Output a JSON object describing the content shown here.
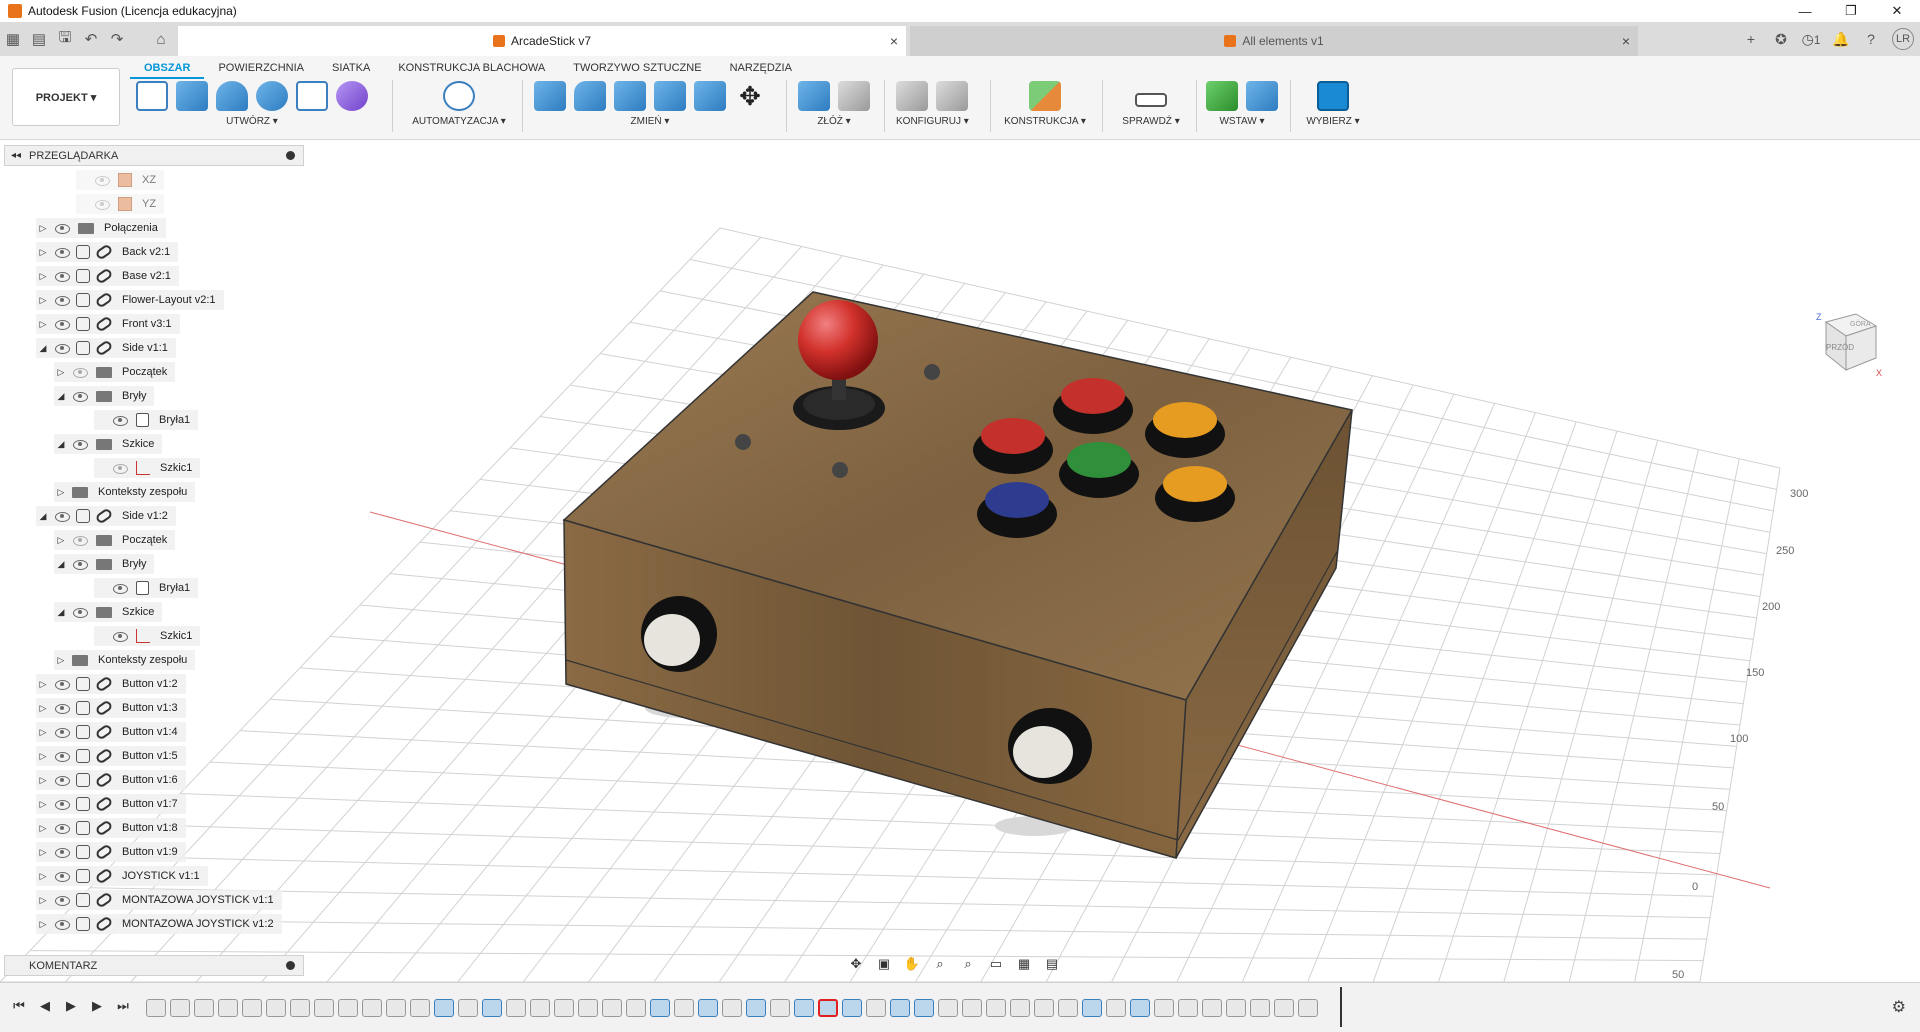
{
  "window": {
    "title": "Autodesk Fusion (Licencja edukacyjna)"
  },
  "tabs": [
    {
      "label": "ArcadeStick v7",
      "active": true
    },
    {
      "label": "All elements v1",
      "active": false
    }
  ],
  "header_right": {
    "job_count": "1",
    "user_initials": "LR"
  },
  "ribbon": {
    "projekt": "PROJEKT ▾",
    "tabs": [
      "OBSZAR",
      "POWIERZCHNIA",
      "SIATKA",
      "KONSTRUKCJA BLACHOWA",
      "TWORZYWO SZTUCZNE",
      "NARZĘDZIA"
    ],
    "groups": [
      "UTWÓRZ ▾",
      "AUTOMATYZACJA ▾",
      "ZMIEŃ ▾",
      "ZŁÓŻ ▾",
      "KONFIGURUJ ▾",
      "KONSTRUKCJA ▾",
      "SPRAWDŹ ▾",
      "WSTAW ▾",
      "WYBIERZ ▾"
    ]
  },
  "browser": {
    "title": "PRZEGLĄDARKA",
    "items": [
      {
        "label": "XZ"
      },
      {
        "label": "YZ"
      },
      {
        "label": "Połączenia"
      },
      {
        "label": "Back v2:1"
      },
      {
        "label": "Base v2:1"
      },
      {
        "label": "Flower-Layout v2:1"
      },
      {
        "label": "Front v3:1"
      },
      {
        "label": "Side v1:1"
      },
      {
        "label": "Początek"
      },
      {
        "label": "Bryły"
      },
      {
        "label": "Bryła1"
      },
      {
        "label": "Szkice"
      },
      {
        "label": "Szkic1"
      },
      {
        "label": "Konteksty zespołu"
      },
      {
        "label": "Side v1:2"
      },
      {
        "label": "Początek"
      },
      {
        "label": "Bryły"
      },
      {
        "label": "Bryła1"
      },
      {
        "label": "Szkice"
      },
      {
        "label": "Szkic1"
      },
      {
        "label": "Konteksty zespołu"
      },
      {
        "label": "Button v1:2"
      },
      {
        "label": "Button v1:3"
      },
      {
        "label": "Button v1:4"
      },
      {
        "label": "Button v1:5"
      },
      {
        "label": "Button v1:6"
      },
      {
        "label": "Button v1:7"
      },
      {
        "label": "Button v1:8"
      },
      {
        "label": "Button v1:9"
      },
      {
        "label": "JOYSTICK v1:1"
      },
      {
        "label": "MONTAZOWA JOYSTICK v1:1"
      },
      {
        "label": "MONTAZOWA JOYSTICK v1:2"
      }
    ]
  },
  "comment_panel": {
    "title": "KOMENTARZ"
  },
  "viewcube": {
    "top": "GÓRA",
    "front": "PRZÓD",
    "axis_z": "Z",
    "axis_x": "X"
  },
  "grid_labels": [
    "300",
    "250",
    "200",
    "150",
    "100",
    "50",
    "0",
    "50"
  ],
  "colors": {
    "accent": "#0696d7",
    "wood": "#8a6a44",
    "button_red": "#c4302b",
    "button_green": "#2f8f3a",
    "button_orange": "#e69b21",
    "button_blue": "#2e3c8f"
  }
}
